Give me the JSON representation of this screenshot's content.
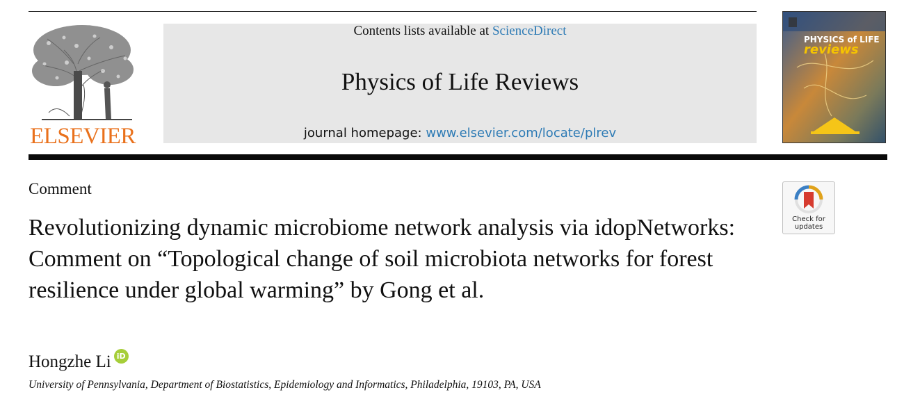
{
  "header": {
    "publisher": "ELSEVIER",
    "contents_prefix": "Contents lists available at ",
    "contents_link": "ScienceDirect",
    "journal_title": "Physics of Life Reviews",
    "homepage_prefix": "journal homepage: ",
    "homepage_link": "www.elsevier.com/locate/plrev",
    "cover_title_line1": "PHYSICS of LIFE",
    "cover_title_line2": "reviews"
  },
  "article": {
    "type": "Comment",
    "title": "Revolutionizing dynamic microbiome network analysis via idopNetworks: Comment on “Topological change of soil microbiota networks for forest resilience under global warming” by Gong et al.",
    "author": "Hongzhe Li",
    "orcid_glyph": "iD",
    "affiliation": "University of Pennsylvania, Department of Biostatistics, Epidemiology and Informatics, Philadelphia, 19103, PA, USA"
  },
  "badge": {
    "line1": "Check for",
    "line2": "updates"
  },
  "colors": {
    "publisher_orange": "#e9711c",
    "link_blue": "#2e7bb5",
    "journal_box_grey": "#e7e7e7",
    "orcid_green": "#a6ce39"
  }
}
